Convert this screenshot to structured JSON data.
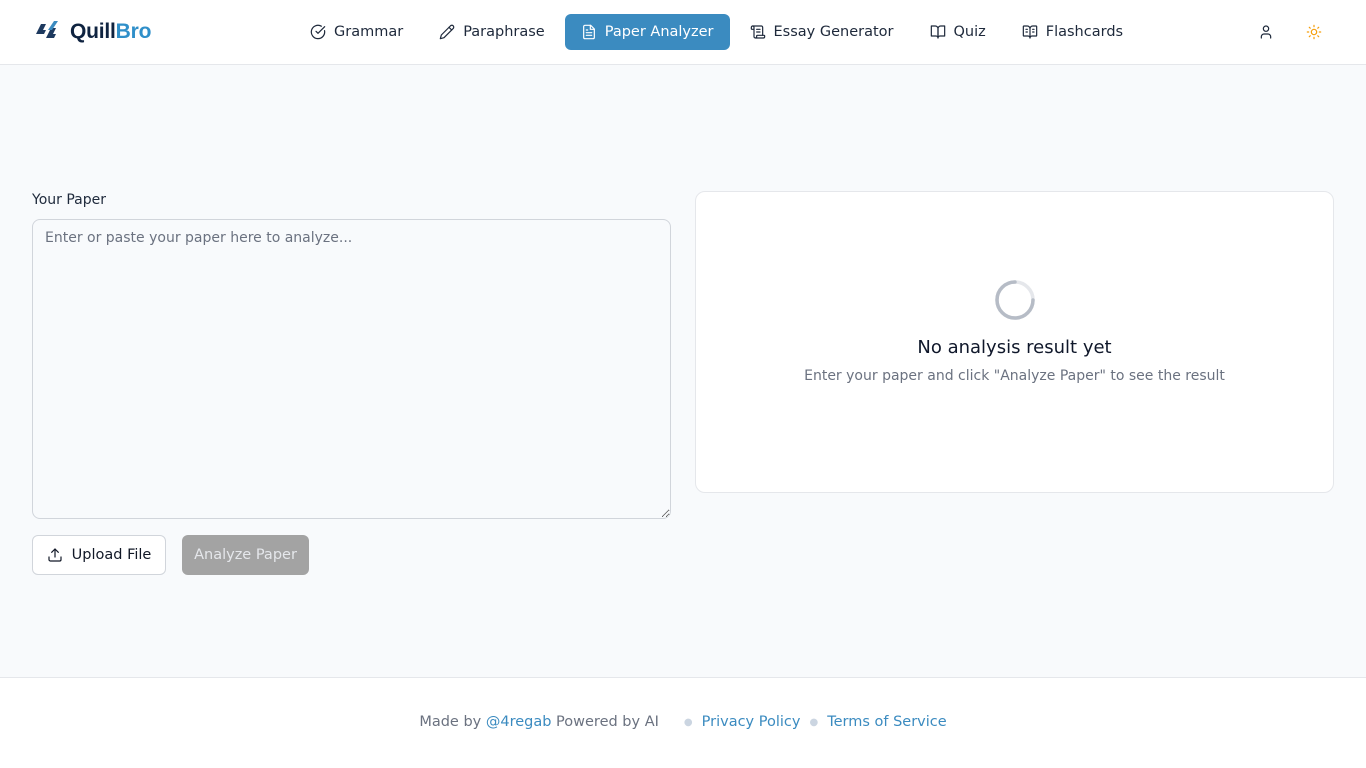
{
  "header": {
    "logo": {
      "brand_main": "Quill",
      "brand_accent": "Bro"
    },
    "nav": [
      {
        "label": "Grammar",
        "icon": "check-circle-icon"
      },
      {
        "label": "Paraphrase",
        "icon": "pencil-icon"
      },
      {
        "label": "Paper Analyzer",
        "icon": "document-icon",
        "active": true
      },
      {
        "label": "Essay Generator",
        "icon": "scroll-icon"
      },
      {
        "label": "Quiz",
        "icon": "book-open-icon"
      },
      {
        "label": "Flashcards",
        "icon": "book-bookmark-icon"
      }
    ],
    "actions": {
      "user_icon": "user-icon",
      "theme_icon": "sun-icon"
    }
  },
  "editor": {
    "label": "Your Paper",
    "placeholder": "Enter or paste your paper here to analyze...",
    "value": "",
    "upload_label": "Upload File",
    "analyze_label": "Analyze Paper"
  },
  "result": {
    "title": "No analysis result yet",
    "subtitle": "Enter your paper and click \"Analyze Paper\" to see the result"
  },
  "footer": {
    "made_by": "Made by",
    "author": "@4regab",
    "powered": "Powered by AI",
    "privacy": "Privacy Policy",
    "terms": "Terms of Service"
  },
  "colors": {
    "accent": "#3b8bc0",
    "logo_dark": "#0f2340",
    "sun": "#f59e0b",
    "disabled_button": "#a3a3a3",
    "background": "#f8fafc"
  }
}
